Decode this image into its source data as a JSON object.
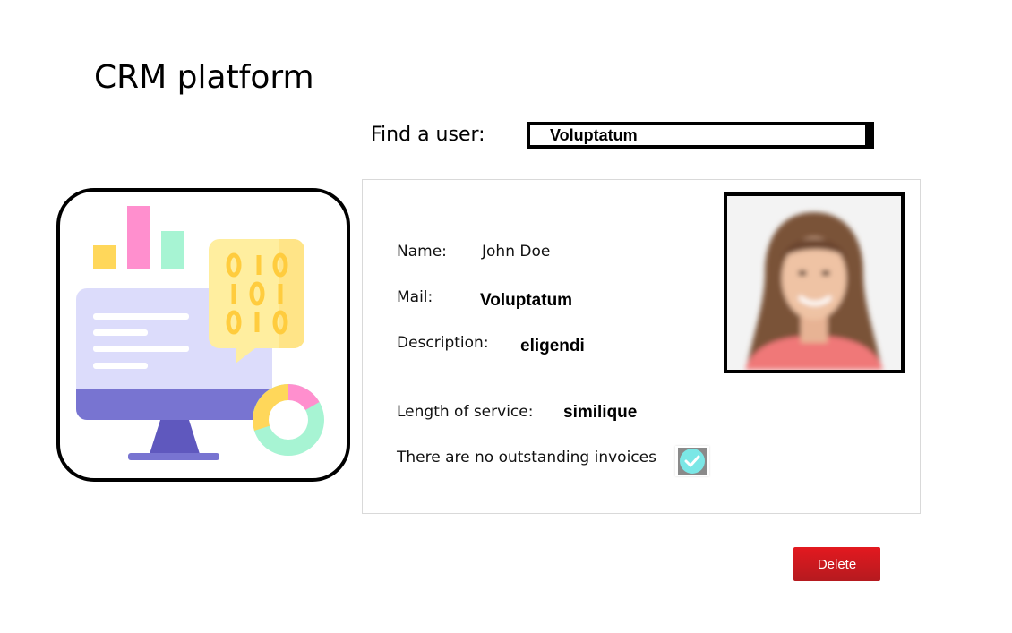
{
  "app": {
    "title": "CRM platform"
  },
  "search": {
    "label": "Find a user:",
    "value": "Voluptatum"
  },
  "profile": {
    "name_label": "Name:",
    "name_value": "John Doe",
    "mail_label": "Mail:",
    "mail_value": "Voluptatum",
    "description_label": "Description:",
    "description_value": "eligendi",
    "service_label": "Length of service:",
    "service_value": "similique",
    "invoices_status": "There are no outstanding invoices",
    "invoices_icon": "check-circle-icon"
  },
  "actions": {
    "delete_label": "Delete"
  },
  "colors": {
    "delete_button": "#d71920",
    "check": "#7be7e6"
  }
}
